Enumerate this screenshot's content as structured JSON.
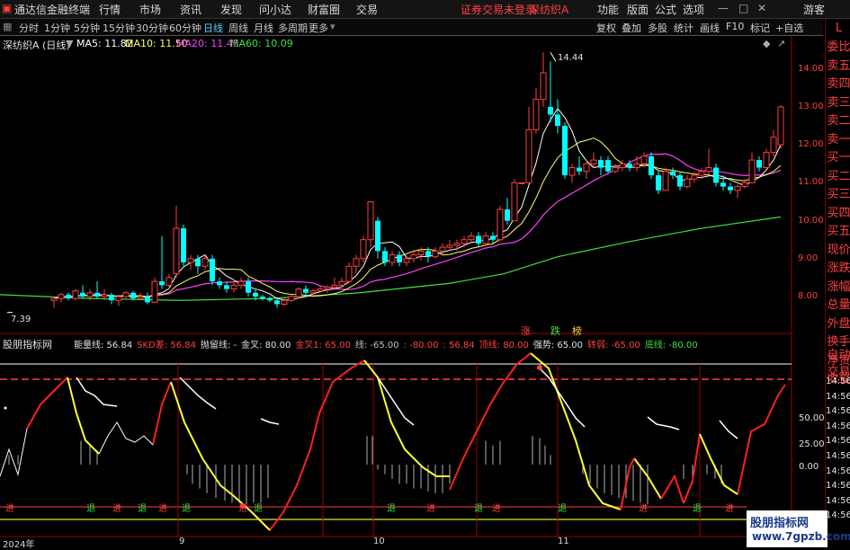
{
  "menubar": {
    "app_title": "通达信金融终端",
    "menus": [
      "行情",
      "市场",
      "资讯",
      "发现",
      "问小达",
      "财富圈",
      "交易"
    ],
    "notice": "证券交易未登录",
    "stock_name": "深纺织A",
    "right_menus": [
      "功能",
      "版面",
      "公式",
      "选项"
    ],
    "guest": "游客"
  },
  "toolbar": {
    "periods": [
      "分时",
      "1分钟",
      "5分钟",
      "15分钟",
      "30分钟",
      "60分钟",
      "日线",
      "周线",
      "月线",
      "多周期",
      "更多"
    ],
    "active_period": "日线",
    "right_items": [
      "复权",
      "叠加",
      "多股",
      "统计",
      "画线",
      "F10",
      "标记",
      "+自选"
    ]
  },
  "right_panel": {
    "items": [
      "委比",
      "卖五",
      "卖四",
      "卖三",
      "卖二",
      "卖一",
      "买一",
      "买二",
      "买三",
      "买四",
      "买五",
      "现价",
      "涨跌",
      "涨幅",
      "总量",
      "外盘",
      "换手",
      "净资",
      "收益"
    ],
    "bottom_items": [
      "自动",
      "交易"
    ],
    "corner": "L"
  },
  "main_legend": {
    "title": "深纺织A (日线)",
    "ma5": "MA5: 11.82",
    "ma10": "MA10: 11.50",
    "ma20": "MA20: 11.45",
    "ma60": "MA60: 10.09"
  },
  "main_axis": [
    "14.00",
    "13.00",
    "12.00",
    "11.00",
    "10.00",
    "9.00",
    "8.00"
  ],
  "annotations": {
    "high": "14.44",
    "low": "7.39",
    "markers": [
      "涨",
      "跌",
      "榜"
    ]
  },
  "indicator_legend": {
    "name": "股朋指标网",
    "items": [
      {
        "text": "能量线: 56.84",
        "color": "#e0e0e0"
      },
      {
        "text": "SKD差: 56.84",
        "color": "#ff4040"
      },
      {
        "text": "抛留线: -",
        "color": "#e0e0e0"
      },
      {
        "text": "金叉: 80.00",
        "color": "#e0e0e0"
      },
      {
        "text": "金叉1: 65.00",
        "color": "#ff4040"
      },
      {
        "text": "线: -65.00",
        "color": "#c0c0c0"
      },
      {
        "text": ": -80.00",
        "color": "#ff4040"
      },
      {
        "text": ": 56.84",
        "color": "#ff4040"
      },
      {
        "text": "顶线: 80.00",
        "color": "#ff4040"
      },
      {
        "text": "强势: 65.00",
        "color": "#e0e0e0"
      },
      {
        "text": "转弱: -65.00",
        "color": "#ff4040"
      },
      {
        "text": "底线: -80.00",
        "color": "#40e040"
      }
    ]
  },
  "indicator_axis": [
    "50.00",
    "25.00",
    "0.00"
  ],
  "indicator_axis_time": [
    "14:56",
    "14:56",
    "14:56",
    "14:56",
    "14:56",
    "14:56",
    "14:56",
    "14:56",
    "14:56",
    "14:56"
  ],
  "signals": [
    {
      "t": "进",
      "c": "#ff4040"
    },
    {
      "t": "退",
      "c": "#40e040"
    },
    {
      "t": "进",
      "c": "#ff4040"
    },
    {
      "t": "退",
      "c": "#40e040"
    },
    {
      "t": "进",
      "c": "#ff4040"
    },
    {
      "t": "退",
      "c": "#40e040"
    },
    {
      "t": "进",
      "c": "#ff4040"
    },
    {
      "t": "退",
      "c": "#40e040"
    },
    {
      "t": "退",
      "c": "#40e040"
    },
    {
      "t": "进",
      "c": "#ff4040"
    },
    {
      "t": "退",
      "c": "#40e040"
    },
    {
      "t": "进",
      "c": "#ff4040"
    },
    {
      "t": "退",
      "c": "#40e040"
    },
    {
      "t": "进",
      "c": "#ff4040"
    },
    {
      "t": "退",
      "c": "#40e040"
    },
    {
      "t": "进",
      "c": "#ff4040"
    }
  ],
  "dates": [
    "2024年",
    "9",
    "10",
    "11"
  ],
  "watermark": {
    "line1": "股朋指标网",
    "line2": "www.7gpzb.com"
  },
  "colors": {
    "up": "#ff4040",
    "down": "#00ffff",
    "ma5": "#ffffff",
    "ma10": "#ffff60",
    "ma20": "#ff40ff",
    "ma60": "#40e040"
  }
}
